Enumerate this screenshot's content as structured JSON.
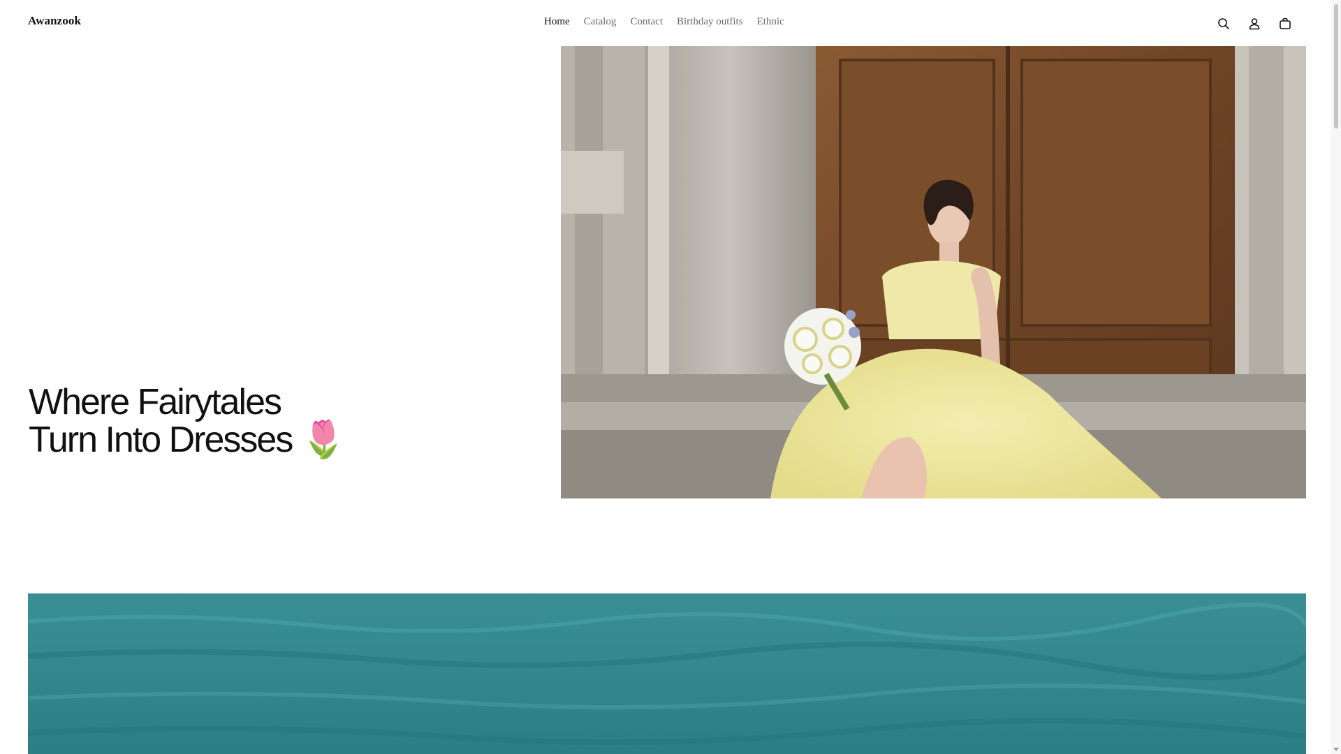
{
  "store": {
    "name": "Awanzook"
  },
  "nav": {
    "items": [
      {
        "label": "Home",
        "active": true
      },
      {
        "label": "Catalog",
        "active": false
      },
      {
        "label": "Contact",
        "active": false
      },
      {
        "label": "Birthday outfits",
        "active": false
      },
      {
        "label": "Ethnic",
        "active": false
      }
    ]
  },
  "header_icons": [
    "search-icon",
    "account-icon",
    "cart-icon"
  ],
  "hero": {
    "heading_line1": "Where Fairytales",
    "heading_line2": "Turn Into Dresses 🌷",
    "image_description_icon": "photo-woman-yellow-dress"
  },
  "colors": {
    "text": "#111111",
    "nav_muted": "#6b6b6b",
    "background": "#ffffff",
    "sea": "#2e8c8c"
  }
}
